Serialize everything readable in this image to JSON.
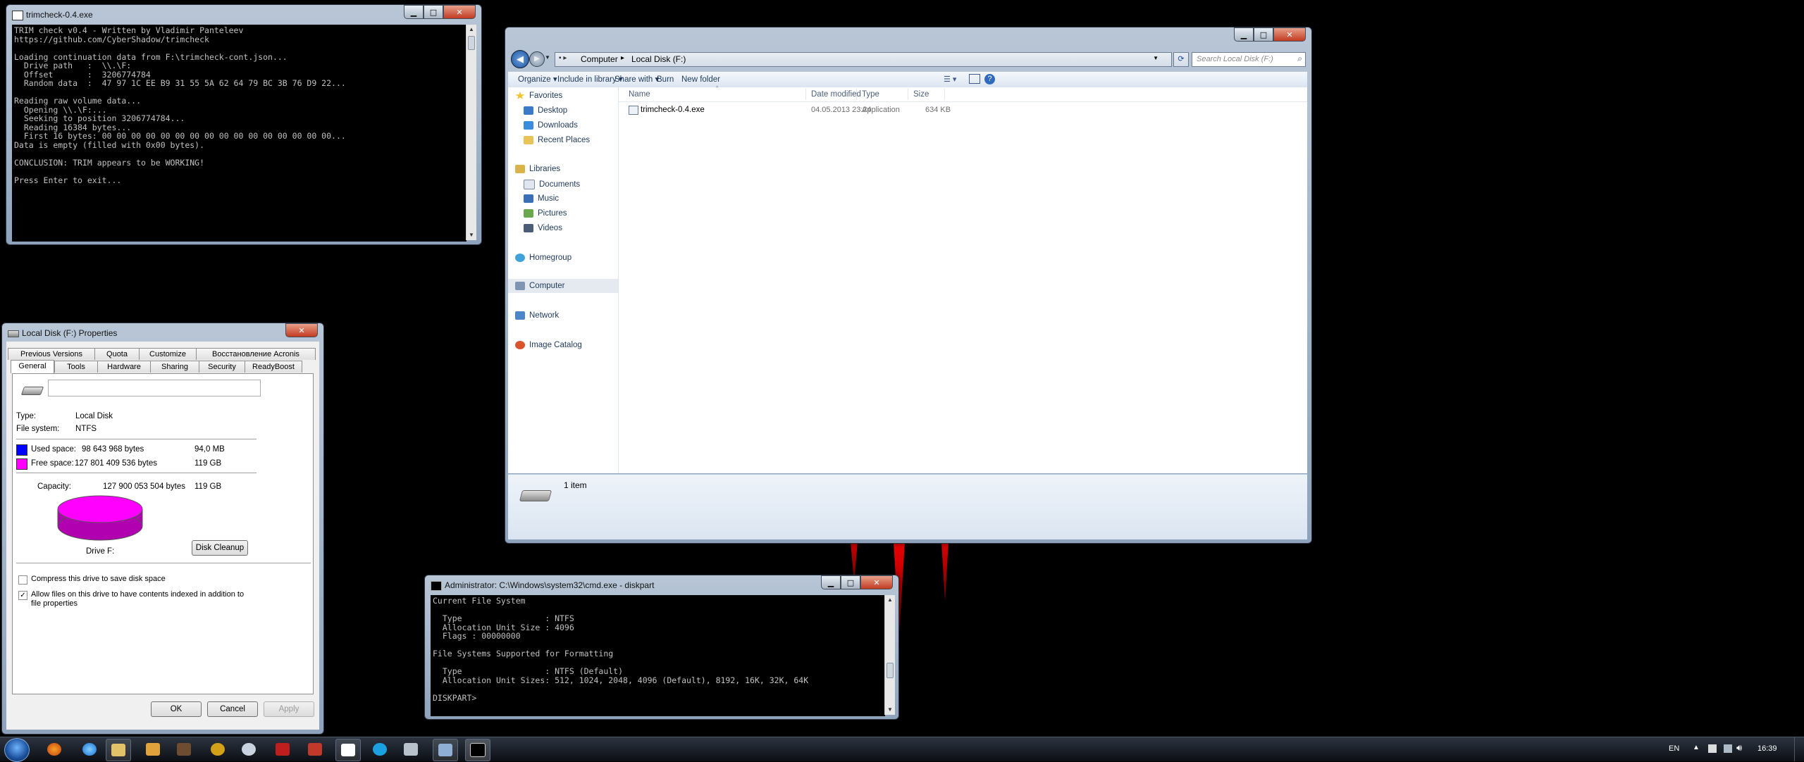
{
  "trimcheck_window": {
    "title": "trimcheck-0.4.exe",
    "console_lines": [
      "TRIM check v0.4 - Written by Vladimir Panteleev",
      "https://github.com/CyberShadow/trimcheck",
      "",
      "Loading continuation data from F:\\trimcheck-cont.json...",
      "  Drive path   :  \\\\.\\F:",
      "  Offset       :  3206774784",
      "  Random data  :  47 97 1C EE B9 31 55 5A 62 64 79 BC 3B 76 D9 22...",
      "",
      "Reading raw volume data...",
      "  Opening \\\\.\\F:...",
      "  Seeking to position 3206774784...",
      "  Reading 16384 bytes...",
      "  First 16 bytes: 00 00 00 00 00 00 00 00 00 00 00 00 00 00 00 00...",
      "Data is empty (filled with 0x00 bytes).",
      "",
      "CONCLUSION: TRIM appears to be WORKING!",
      "",
      "Press Enter to exit..."
    ]
  },
  "explorer": {
    "address": {
      "parts": [
        "Computer",
        "Local Disk (F:)"
      ]
    },
    "search_placeholder": "Search Local Disk (F:)",
    "commands": [
      "Organize ▾",
      "Include in library ▾",
      "Share with ▾",
      "Burn",
      "New folder"
    ],
    "nav": {
      "favorites": "Favorites",
      "favorites_items": [
        "Desktop",
        "Downloads",
        "Recent Places"
      ],
      "libraries": "Libraries",
      "libraries_items": [
        "Documents",
        "Music",
        "Pictures",
        "Videos"
      ],
      "homegroup": "Homegroup",
      "computer": "Computer",
      "network": "Network",
      "image_catalog": "Image Catalog"
    },
    "columns": [
      "Name",
      "Date modified",
      "Type",
      "Size"
    ],
    "files": [
      {
        "name": "trimcheck-0.4.exe",
        "date": "04.05.2013 23:24",
        "type": "Application",
        "size": "634 KB"
      }
    ],
    "status": "1 item"
  },
  "properties": {
    "title": "Local Disk (F:) Properties",
    "tabs_row1": [
      "Previous Versions",
      "Quota",
      "Customize",
      "Восстановление Acronis"
    ],
    "tabs_row2": [
      "General",
      "Tools",
      "Hardware",
      "Sharing",
      "Security",
      "ReadyBoost"
    ],
    "type_label": "Type:",
    "type_value": "Local Disk",
    "fs_label": "File system:",
    "fs_value": "NTFS",
    "used_label": "Used space:",
    "used_bytes": "98 643 968 bytes",
    "used_size": "94,0 MB",
    "free_label": "Free space:",
    "free_bytes": "127 801 409 536 bytes",
    "free_size": "119 GB",
    "capacity_label": "Capacity:",
    "capacity_bytes": "127 900 053 504 bytes",
    "capacity_size": "119 GB",
    "drive_label": "Drive F:",
    "cleanup": "Disk Cleanup",
    "compress": "Compress this drive to save disk space",
    "index_line1": "Allow files on this drive to have contents indexed in addition to",
    "index_line2": "file properties",
    "ok": "OK",
    "cancel": "Cancel",
    "apply": "Apply",
    "colors": {
      "used": "#0000ff",
      "free": "#ff00ff"
    }
  },
  "cmd_window": {
    "title": "Administrator: C:\\Windows\\system32\\cmd.exe - diskpart",
    "console_lines": [
      "Current File System",
      "",
      "  Type                 : NTFS",
      "  Allocation Unit Size : 4096",
      "  Flags : 00000000",
      "",
      "File Systems Supported for Formatting",
      "",
      "  Type                 : NTFS (Default)",
      "  Allocation Unit Sizes: 512, 1024, 2048, 4096 (Default), 8192, 16K, 32K, 64K",
      "",
      "DISKPART>"
    ]
  },
  "taskbar": {
    "lang": "EN",
    "time": "16:39"
  }
}
